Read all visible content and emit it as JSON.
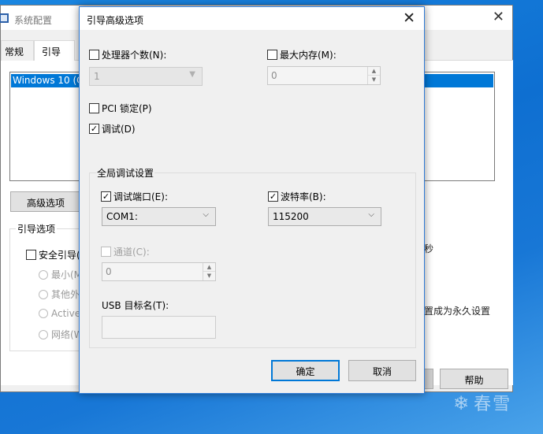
{
  "background_window": {
    "title": "系统配置",
    "tabs": [
      {
        "label": "常规"
      },
      {
        "label": "引导"
      }
    ],
    "os_list": [
      {
        "label": "Windows 10 (C"
      }
    ],
    "advanced_button": "高级选项",
    "boot_options": {
      "legend": "引导选项",
      "safe_boot": "安全引导(",
      "radios": [
        "最小(M",
        "其他外",
        "Active",
        "网络(W"
      ]
    },
    "seconds_suffix": "秒",
    "permanent_text": "置成为永久设置",
    "help_button": "帮助"
  },
  "dialog": {
    "title": "引导高级选项",
    "close_glyph": "✕",
    "processor_count": {
      "label": "处理器个数(N):",
      "checked": false,
      "value": "1"
    },
    "max_memory": {
      "label": "最大内存(M):",
      "checked": false,
      "value": "0"
    },
    "pci_lock": {
      "label": "PCI 锁定(P)",
      "checked": false
    },
    "debug": {
      "label": "调试(D)",
      "checked": true
    },
    "global_debug": {
      "legend": "全局调试设置",
      "debug_port": {
        "label": "调试端口(E):",
        "checked": true,
        "value": "COM1:"
      },
      "baud_rate": {
        "label": "波特率(B):",
        "checked": true,
        "value": "115200"
      },
      "channel": {
        "label": "通道(C):",
        "checked": false,
        "value": "0"
      },
      "usb_target": {
        "label": "USB 目标名(T):",
        "value": ""
      }
    },
    "ok_button": "确定",
    "cancel_button": "取消"
  },
  "watermark": {
    "icon": "snowflake-icon",
    "text": "春雪"
  }
}
